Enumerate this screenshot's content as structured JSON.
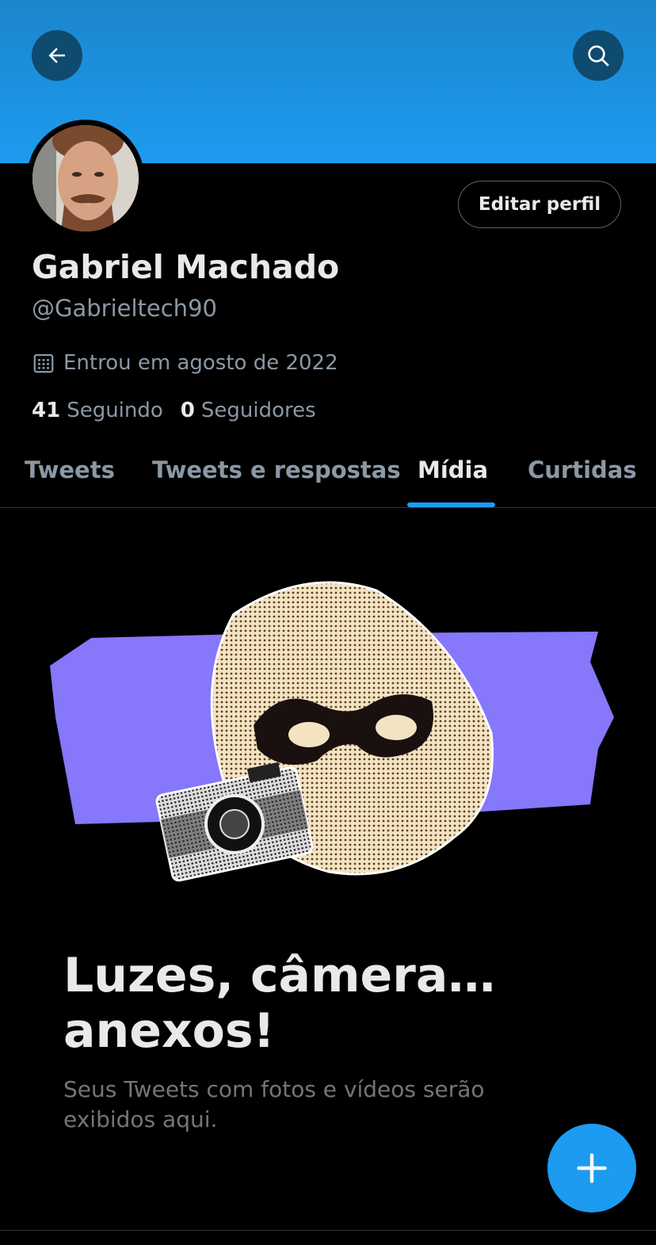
{
  "header": {
    "back_icon": "arrow-left-icon",
    "search_icon": "search-icon",
    "banner_color": "#1d9bf0"
  },
  "profile": {
    "name": "Gabriel Machado",
    "handle": "@Gabrieltech90",
    "edit_label": "Editar perfil",
    "joined_icon": "calendar-icon",
    "joined": "Entrou em agosto de 2022",
    "following_count": "41",
    "following_label": "Seguindo",
    "followers_count": "0",
    "followers_label": "Seguidores"
  },
  "tabs": [
    {
      "label": "Tweets",
      "active": false
    },
    {
      "label": "Tweets e respostas",
      "active": false
    },
    {
      "label": "Mídia",
      "active": true
    },
    {
      "label": "Curtidas",
      "active": false
    }
  ],
  "empty_state": {
    "title": "Luzes, câmera… anexos!",
    "subtitle": "Seus Tweets com fotos e vídeos serão exibidos aqui."
  },
  "fab": {
    "icon": "plus-icon",
    "color": "#1d9bf0"
  },
  "colors": {
    "accent": "#1d9bf0",
    "illustration_band": "#8677fb"
  }
}
